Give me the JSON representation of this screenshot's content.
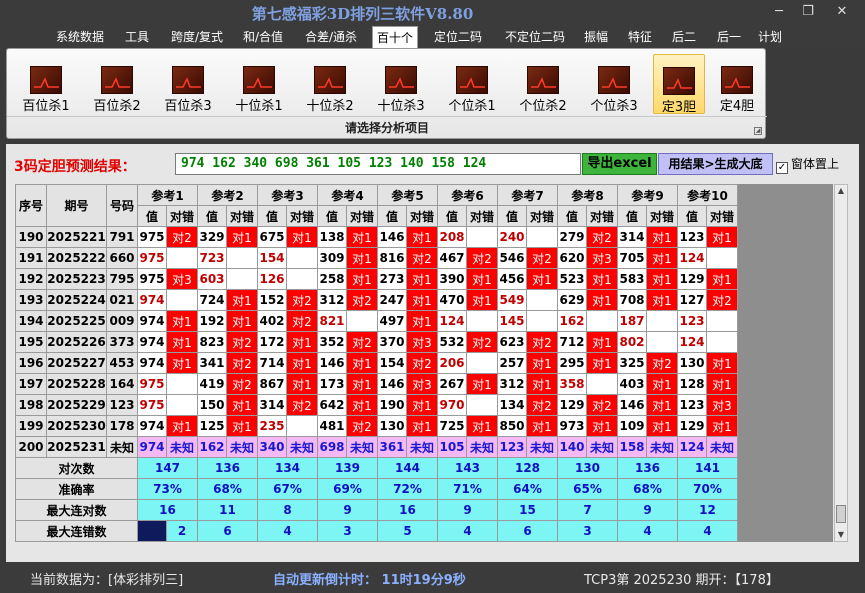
{
  "window": {
    "title": "第七感福彩3D排列三软件V8.80",
    "min": "─",
    "restore": "❐",
    "close": "✕"
  },
  "menus": [
    "系统数据",
    "工具",
    "跨度/复式",
    "和/合值",
    "合差/通杀",
    "百十个",
    "定位二码",
    "不定位二码",
    "振幅",
    "特征",
    "后二",
    "后一",
    "计划"
  ],
  "active_menu": "百十个",
  "ribbon": {
    "buttons": [
      "百位杀1",
      "百位杀2",
      "百位杀3",
      "十位杀1",
      "十位杀2",
      "十位杀3",
      "个位杀1",
      "个位杀2",
      "个位杀3",
      "定3胆",
      "定4胆"
    ],
    "selected": "定3胆",
    "caption": "请选择分析项目"
  },
  "result": {
    "label": "3码定胆预测结果：",
    "value": "974 162 340 698 361 105 123 140 158 124",
    "excel_button": "导出excel",
    "gen_button": "用结果>生成大底",
    "topmost_label": "窗体置上",
    "topmost_mark": "✓"
  },
  "grid": {
    "col_headers": {
      "seq": "序号",
      "period": "期号",
      "number": "号码",
      "refs": [
        "参考1",
        "参考2",
        "参考3",
        "参考4",
        "参考5",
        "参考6",
        "参考7",
        "参考8",
        "参考9",
        "参考10"
      ],
      "value": "值",
      "hit": "对错"
    },
    "rows": [
      {
        "seq": "190",
        "period": "2025221",
        "num": "791",
        "cells": [
          [
            "975",
            "对2",
            0
          ],
          [
            "329",
            "对1",
            0
          ],
          [
            "675",
            "对1",
            0
          ],
          [
            "138",
            "对1",
            0
          ],
          [
            "146",
            "对1",
            0
          ],
          [
            "208",
            "",
            1
          ],
          [
            "240",
            "",
            1
          ],
          [
            "279",
            "对2",
            0
          ],
          [
            "314",
            "对1",
            0
          ],
          [
            "123",
            "对1",
            0
          ]
        ]
      },
      {
        "seq": "191",
        "period": "2025222",
        "num": "660",
        "cells": [
          [
            "975",
            "",
            1
          ],
          [
            "723",
            "",
            1
          ],
          [
            "154",
            "",
            1
          ],
          [
            "309",
            "对1",
            0
          ],
          [
            "816",
            "对2",
            0
          ],
          [
            "467",
            "对2",
            0
          ],
          [
            "546",
            "对2",
            0
          ],
          [
            "620",
            "对3",
            0
          ],
          [
            "705",
            "对1",
            0
          ],
          [
            "124",
            "",
            1
          ]
        ]
      },
      {
        "seq": "192",
        "period": "2025223",
        "num": "795",
        "cells": [
          [
            "975",
            "对3",
            0
          ],
          [
            "603",
            "",
            1
          ],
          [
            "126",
            "",
            1
          ],
          [
            "258",
            "对1",
            0
          ],
          [
            "273",
            "对1",
            0
          ],
          [
            "390",
            "对1",
            0
          ],
          [
            "456",
            "对1",
            0
          ],
          [
            "523",
            "对1",
            0
          ],
          [
            "583",
            "对1",
            0
          ],
          [
            "129",
            "对1",
            0
          ]
        ]
      },
      {
        "seq": "193",
        "period": "2025224",
        "num": "021",
        "cells": [
          [
            "974",
            "",
            1
          ],
          [
            "724",
            "对1",
            0
          ],
          [
            "152",
            "对2",
            0
          ],
          [
            "312",
            "对2",
            0
          ],
          [
            "247",
            "对1",
            0
          ],
          [
            "470",
            "对1",
            0
          ],
          [
            "549",
            "",
            1
          ],
          [
            "629",
            "对1",
            0
          ],
          [
            "708",
            "对1",
            0
          ],
          [
            "127",
            "对2",
            0
          ]
        ]
      },
      {
        "seq": "194",
        "period": "2025225",
        "num": "009",
        "cells": [
          [
            "974",
            "对1",
            0
          ],
          [
            "192",
            "对1",
            0
          ],
          [
            "402",
            "对2",
            0
          ],
          [
            "821",
            "",
            1
          ],
          [
            "497",
            "对1",
            0
          ],
          [
            "124",
            "",
            1
          ],
          [
            "145",
            "",
            1
          ],
          [
            "162",
            "",
            1
          ],
          [
            "187",
            "",
            1
          ],
          [
            "123",
            "",
            1
          ]
        ]
      },
      {
        "seq": "195",
        "period": "2025226",
        "num": "373",
        "cells": [
          [
            "974",
            "对1",
            0
          ],
          [
            "823",
            "对2",
            0
          ],
          [
            "172",
            "对1",
            0
          ],
          [
            "352",
            "对2",
            0
          ],
          [
            "370",
            "对3",
            0
          ],
          [
            "532",
            "对2",
            0
          ],
          [
            "623",
            "对2",
            0
          ],
          [
            "712",
            "对1",
            0
          ],
          [
            "802",
            "",
            1
          ],
          [
            "124",
            "",
            1
          ]
        ]
      },
      {
        "seq": "196",
        "period": "2025227",
        "num": "453",
        "cells": [
          [
            "974",
            "对1",
            0
          ],
          [
            "341",
            "对2",
            0
          ],
          [
            "714",
            "对1",
            0
          ],
          [
            "146",
            "对1",
            0
          ],
          [
            "154",
            "对2",
            0
          ],
          [
            "206",
            "",
            1
          ],
          [
            "257",
            "对1",
            0
          ],
          [
            "295",
            "对1",
            0
          ],
          [
            "325",
            "对2",
            0
          ],
          [
            "130",
            "对1",
            0
          ]
        ]
      },
      {
        "seq": "197",
        "period": "2025228",
        "num": "164",
        "cells": [
          [
            "975",
            "",
            1
          ],
          [
            "419",
            "对2",
            0
          ],
          [
            "867",
            "对1",
            0
          ],
          [
            "173",
            "对1",
            0
          ],
          [
            "146",
            "对3",
            0
          ],
          [
            "267",
            "对1",
            0
          ],
          [
            "312",
            "对1",
            0
          ],
          [
            "358",
            "",
            1
          ],
          [
            "403",
            "对1",
            0
          ],
          [
            "128",
            "对1",
            0
          ]
        ]
      },
      {
        "seq": "198",
        "period": "2025229",
        "num": "123",
        "cells": [
          [
            "975",
            "",
            1
          ],
          [
            "150",
            "对1",
            0
          ],
          [
            "314",
            "对2",
            0
          ],
          [
            "642",
            "对1",
            0
          ],
          [
            "190",
            "对1",
            0
          ],
          [
            "970",
            "",
            1
          ],
          [
            "134",
            "对2",
            0
          ],
          [
            "129",
            "对2",
            0
          ],
          [
            "146",
            "对1",
            0
          ],
          [
            "123",
            "对3",
            0
          ]
        ]
      },
      {
        "seq": "199",
        "period": "2025230",
        "num": "178",
        "cells": [
          [
            "974",
            "对1",
            0
          ],
          [
            "125",
            "对1",
            0
          ],
          [
            "235",
            "",
            1
          ],
          [
            "481",
            "对2",
            0
          ],
          [
            "130",
            "对1",
            0
          ],
          [
            "725",
            "对1",
            0
          ],
          [
            "850",
            "对1",
            0
          ],
          [
            "973",
            "对1",
            0
          ],
          [
            "109",
            "对1",
            0
          ],
          [
            "129",
            "对1",
            0
          ]
        ]
      }
    ],
    "current": {
      "seq": "200",
      "period": "2025231",
      "num": "未知",
      "cells": [
        [
          "974",
          "未知"
        ],
        [
          "162",
          "未知"
        ],
        [
          "340",
          "未知"
        ],
        [
          "698",
          "未知"
        ],
        [
          "361",
          "未知"
        ],
        [
          "105",
          "未知"
        ],
        [
          "123",
          "未知"
        ],
        [
          "140",
          "未知"
        ],
        [
          "158",
          "未知"
        ],
        [
          "124",
          "未知"
        ]
      ]
    },
    "stats": [
      {
        "label": "对次数",
        "values": [
          "147",
          "136",
          "134",
          "139",
          "144",
          "143",
          "128",
          "130",
          "136",
          "141"
        ]
      },
      {
        "label": "准确率",
        "values": [
          "73%",
          "68%",
          "67%",
          "69%",
          "72%",
          "71%",
          "64%",
          "65%",
          "68%",
          "70%"
        ]
      },
      {
        "label": "最大连对数",
        "values": [
          "16",
          "11",
          "8",
          "9",
          "16",
          "9",
          "15",
          "7",
          "9",
          "12"
        ]
      },
      {
        "label": "最大连错数",
        "values": [
          "2",
          "6",
          "4",
          "3",
          "5",
          "4",
          "6",
          "3",
          "4",
          "4"
        ]
      }
    ]
  },
  "status": {
    "left": "当前数据为：[体彩排列三]",
    "countdown": "自动更新倒计时：  11时19分9秒",
    "right": "TCP3第  2025230  期开：【178】"
  },
  "colors": {
    "hit": "#ff0000",
    "miss_value": "#c00000",
    "stat_bg": "#7df5f5",
    "current_bg": "#f4b8f4",
    "result_text": "#008000"
  }
}
